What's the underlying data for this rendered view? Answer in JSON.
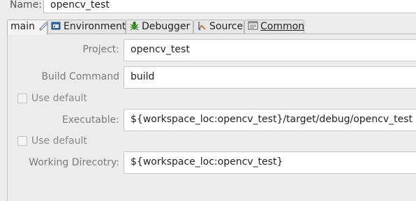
{
  "name_row": {
    "label": "Name:",
    "value": "opencv_test"
  },
  "tabs": [
    {
      "label": "main",
      "icon": "main-tab-icon"
    },
    {
      "label": "Environment",
      "icon": "environment-icon"
    },
    {
      "label": "Debugger",
      "icon": "bug-icon"
    },
    {
      "label": "Source",
      "icon": "source-icon"
    },
    {
      "label": "Common",
      "icon": "common-icon"
    }
  ],
  "form": {
    "project_label": "Project:",
    "project_value": "opencv_test",
    "build_label": "Build Command",
    "build_value": "build",
    "use_default_1": "Use default",
    "executable_label": "Executable:",
    "executable_value": "${workspace_loc:opencv_test}/target/debug/opencv_test res",
    "use_default_2": "Use default",
    "workdir_label": "Working Direcotry:",
    "workdir_value": "${workspace_loc:opencv_test}"
  },
  "colors": {
    "accent_blue": "#3a6ea5",
    "bug_green": "#3f8f2a",
    "tab_border": "#b8b8b8"
  }
}
